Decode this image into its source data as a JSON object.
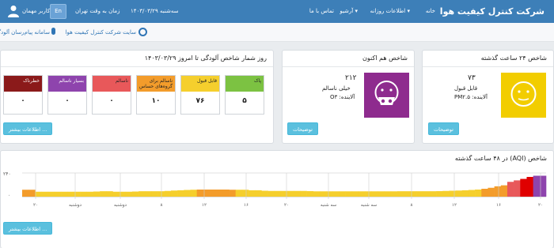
{
  "navbar": {
    "brand": "شرکت کنترل کیفیت هوا",
    "home": "خانه",
    "daily_info": "اطلاعات روزانه",
    "archive": "آرشیو",
    "contact": "تماس با ما",
    "date": "سه‌شنبه ۱۴۰۳/۰۳/۲۹",
    "tehran_time": "زمان به وقت تهران",
    "lang_button": "En",
    "guest_user": "کاربر مهمان"
  },
  "subbar": {
    "site_link": "سایت شرکت کنترل کیفیت هوا",
    "phone_link": "سامانه پیام‌رسان آلودگی هوا"
  },
  "panel_24h": {
    "title": "شاخص ۲۴ ساعت گذشته",
    "aqi": "۷۳",
    "status": "قابل قبول",
    "pollutant": "آلاینده: PM۲.۵",
    "face_color": "#f2cd00",
    "button": "توضیحات"
  },
  "panel_now": {
    "title": "شاخص هم اکنون",
    "aqi": "۲۱۲",
    "status": "خیلی ناسالم",
    "pollutant": "آلاینده: O۳",
    "face_color": "#8e2b8e",
    "button": "توضیحات"
  },
  "panel_days": {
    "title": "روز شمار شاخص آلودگی تا امروز ۱۴۰۳/۰۳/۲۹",
    "button": "اطلاعات بیشتر ...",
    "categories": [
      {
        "label": "پاک",
        "count": "۵",
        "color": "#7cc242"
      },
      {
        "label": "قابل قبول",
        "count": "۷۶",
        "color": "#f5cf2d"
      },
      {
        "label": "ناسالم برای گروه‌های حساس",
        "count": "۱۰",
        "color": "#f39c2b"
      },
      {
        "label": "ناسالم",
        "count": "۰",
        "color": "#e8585a"
      },
      {
        "label": "بسیار ناسالم",
        "count": "۰",
        "color": "#8e44ad"
      },
      {
        "label": "خطرناک",
        "count": "۰",
        "color": "#8b1a1a"
      }
    ]
  },
  "panel_chart": {
    "title": "شاخص (AQI) در ۴۸ ساعت گذشته",
    "button": "اطلاعات بیشتر ...",
    "y_ticks": [
      "۲۴۰",
      "۰"
    ],
    "x_labels": [
      "۲۰",
      "دوشنبه",
      "دوشنبه",
      "۸",
      "۱۲",
      "۱۶",
      "۲۰",
      "سه شنبه",
      "سه شنبه",
      "۸",
      "۱۲",
      "۱۶",
      "۲۰"
    ]
  },
  "chart_data": {
    "type": "bar",
    "title": "شاخص (AQI) در ۴۸ ساعت گذشته",
    "ylim": [
      0,
      240
    ],
    "y_ticks": [
      "۲۴۰",
      "۰"
    ],
    "values": [
      70,
      70,
      50,
      50,
      50,
      50,
      50,
      50,
      50,
      50,
      50,
      52,
      55,
      55,
      50,
      50,
      50,
      52,
      55,
      55,
      55,
      55,
      58,
      62,
      65,
      68,
      70,
      72,
      72,
      72,
      72,
      72,
      70,
      70,
      70,
      65,
      65,
      60,
      58,
      58,
      58,
      58,
      58,
      58,
      56,
      54,
      54,
      54,
      54,
      54,
      54,
      54,
      54,
      54,
      54,
      54,
      54,
      54,
      55,
      55,
      55,
      55,
      55,
      55,
      56,
      58,
      60,
      62,
      65,
      68,
      72,
      80,
      90,
      105,
      115,
      150,
      165,
      180,
      200,
      212,
      212
    ],
    "colors": [
      "#f39c2b",
      "#f39c2b",
      "#f5cf2d",
      "#f5cf2d",
      "#f5cf2d",
      "#f5cf2d",
      "#f5cf2d",
      "#f5cf2d",
      "#f5cf2d",
      "#f5cf2d",
      "#f5cf2d",
      "#f5cf2d",
      "#f5cf2d",
      "#f5cf2d",
      "#f5cf2d",
      "#f5cf2d",
      "#f5cf2d",
      "#f5cf2d",
      "#f5cf2d",
      "#f5cf2d",
      "#f5cf2d",
      "#f5cf2d",
      "#f5cf2d",
      "#f5cf2d",
      "#f5cf2d",
      "#f5cf2d",
      "#f5cf2d",
      "#f39c2b",
      "#f39c2b",
      "#f39c2b",
      "#f39c2b",
      "#f39c2b",
      "#f39c2b",
      "#f5cf2d",
      "#f5cf2d",
      "#f5cf2d",
      "#f5cf2d",
      "#f5cf2d",
      "#f5cf2d",
      "#f5cf2d",
      "#f5cf2d",
      "#f5cf2d",
      "#f5cf2d",
      "#f5cf2d",
      "#f5cf2d",
      "#f5cf2d",
      "#f5cf2d",
      "#f5cf2d",
      "#f5cf2d",
      "#f5cf2d",
      "#f5cf2d",
      "#f5cf2d",
      "#f5cf2d",
      "#f5cf2d",
      "#f5cf2d",
      "#f5cf2d",
      "#f5cf2d",
      "#f5cf2d",
      "#f5cf2d",
      "#f5cf2d",
      "#f5cf2d",
      "#f5cf2d",
      "#f5cf2d",
      "#f5cf2d",
      "#f5cf2d",
      "#f5cf2d",
      "#f5cf2d",
      "#f5cf2d",
      "#f5cf2d",
      "#f5cf2d",
      "#f5cf2d",
      "#f39c2b",
      "#f39c2b",
      "#f39c2b",
      "#f39c2b",
      "#e8585a",
      "#e8585a",
      "#e00000",
      "#e00000",
      "#8e44ad",
      "#8e44ad"
    ]
  }
}
